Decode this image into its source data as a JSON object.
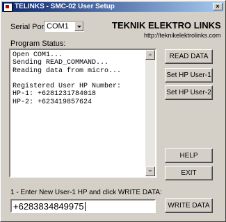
{
  "window": {
    "title": "TELINKS - SMC-02 User Setup",
    "close_glyph": "×"
  },
  "serial": {
    "label": "Serial Port:",
    "selected": "COM1"
  },
  "brand": {
    "name": "TEKNIK ELEKTRO LINKS",
    "url": "http://teknikelektrolinks.com"
  },
  "status": {
    "label": "Program Status:",
    "lines": [
      "Open COM1...",
      "Sending READ_COMMAND...",
      "Reading data from micro...",
      "",
      "Registered User HP Number:",
      "HP-1: +6281231784018",
      "HP-2: +623419857624"
    ]
  },
  "buttons": {
    "read": "READ DATA",
    "set_user1": "Set HP User-1",
    "set_user2": "Set HP User-2",
    "help": "HELP",
    "exit": "EXIT",
    "write": "WRITE DATA"
  },
  "entry": {
    "instruction": "1 - Enter New User-1 HP and click WRITE DATA:",
    "value": "+6283834849975"
  }
}
